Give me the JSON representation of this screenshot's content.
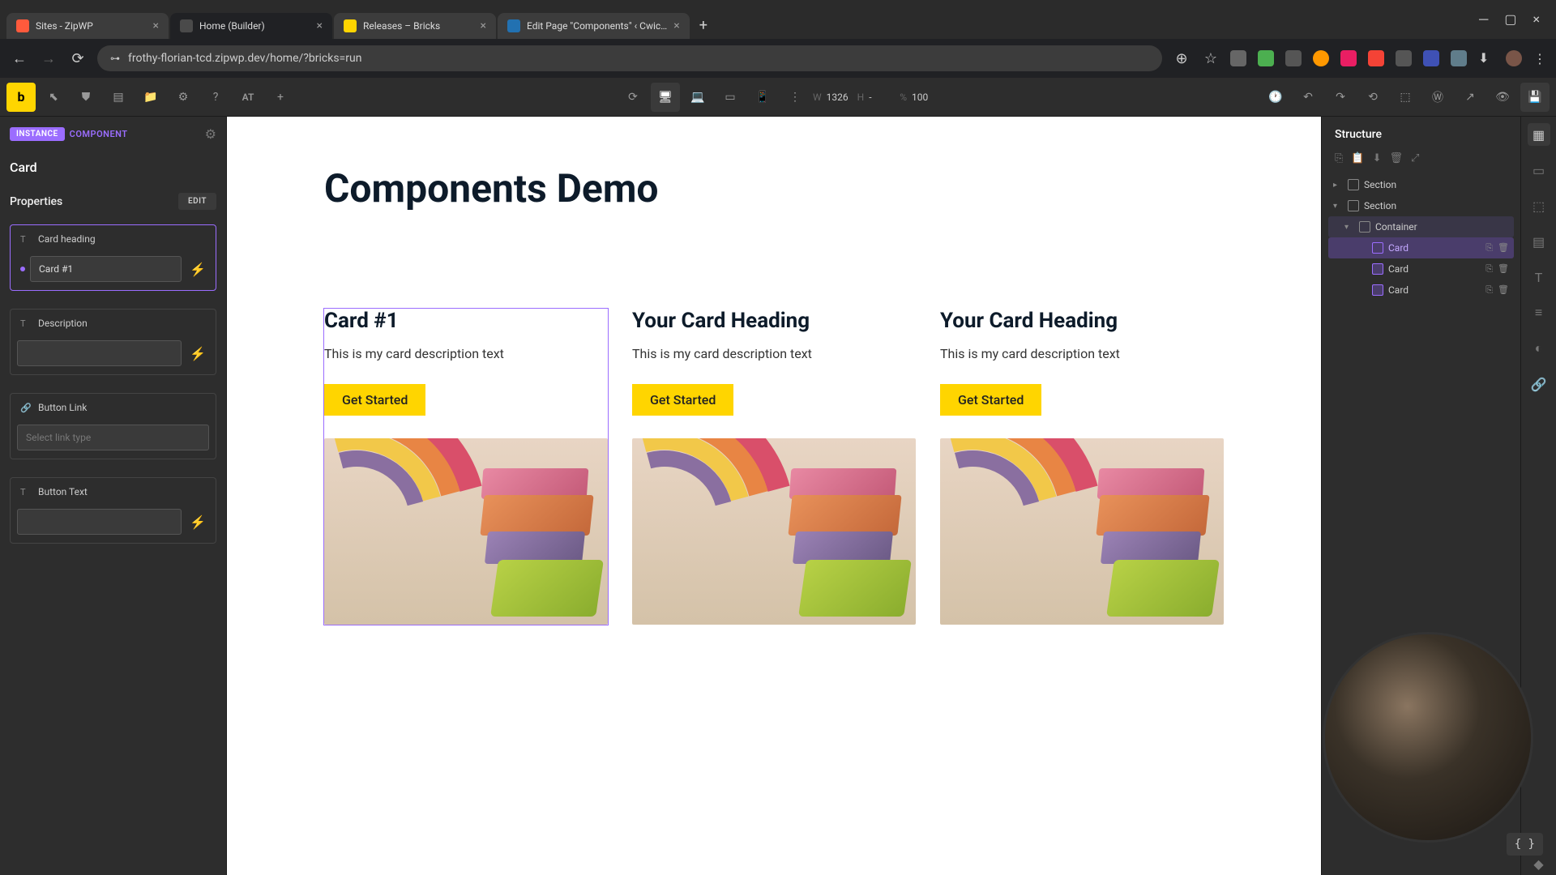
{
  "browser": {
    "tabs": [
      {
        "title": "Sites - ZipWP",
        "favicon": "#ff5a3c"
      },
      {
        "title": "Home (Builder)",
        "favicon": "#4a4a4a",
        "active": true
      },
      {
        "title": "Releases – Bricks",
        "favicon": "#ffd500"
      },
      {
        "title": "Edit Page \"Components\" ‹ Cwic…",
        "favicon": "#2271b1"
      }
    ],
    "url": "frothy-florian-tcd.zipwp.dev/home/?bricks=run"
  },
  "toolbar": {
    "logo": "b",
    "at_label": "AT",
    "dims": {
      "w_label": "W",
      "w_val": "1326",
      "h_label": "H",
      "h_val": "-",
      "pct_label": "%",
      "pct_val": "100"
    }
  },
  "left": {
    "instance_badge": "INSTANCE",
    "component_badge": "COMPONENT",
    "element_name": "Card",
    "properties_title": "Properties",
    "edit_btn": "EDIT",
    "props": {
      "heading_label": "Card heading",
      "heading_value": "Card #1",
      "desc_label": "Description",
      "desc_value": "",
      "link_label": "Button Link",
      "link_placeholder": "Select link type",
      "btntext_label": "Button Text",
      "btntext_value": ""
    }
  },
  "canvas": {
    "heading": "Components Demo",
    "cards": [
      {
        "title": "Card #1",
        "desc": "This is my card description text",
        "btn": "Get Started"
      },
      {
        "title": "Your Card Heading",
        "desc": "This is my card description text",
        "btn": "Get Started"
      },
      {
        "title": "Your Card Heading",
        "desc": "This is my card description text",
        "btn": "Get Started"
      }
    ]
  },
  "right": {
    "title": "Structure",
    "tree": [
      {
        "label": "Section",
        "indent": 0,
        "type": "section",
        "caret": true
      },
      {
        "label": "Section",
        "indent": 0,
        "type": "section",
        "caret": true,
        "expanded": true
      },
      {
        "label": "Container",
        "indent": 1,
        "type": "container",
        "caret": true,
        "expanded": true,
        "bg": true
      },
      {
        "label": "Card",
        "indent": 2,
        "type": "component",
        "selected": true,
        "actions": true
      },
      {
        "label": "Card",
        "indent": 2,
        "type": "component",
        "actions": true
      },
      {
        "label": "Card",
        "indent": 2,
        "type": "component",
        "actions": true
      }
    ]
  },
  "code_badge": "{ }"
}
